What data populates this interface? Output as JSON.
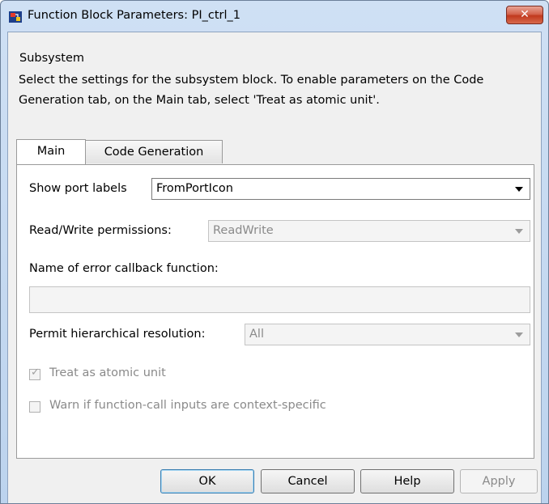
{
  "window": {
    "title": "Function Block Parameters: PI_ctrl_1",
    "close_symbol": "✕"
  },
  "group": {
    "label": "Subsystem",
    "description": "Select the settings for the subsystem block. To enable parameters on the Code Generation tab, on the Main tab, select 'Treat as atomic unit'."
  },
  "tabs": [
    {
      "label": "Main",
      "active": true
    },
    {
      "label": "Code Generation",
      "active": false
    }
  ],
  "main": {
    "show_port_labels": {
      "label": "Show port labels",
      "value": "FromPortIcon"
    },
    "read_write": {
      "label": "Read/Write permissions:",
      "value": "ReadWrite"
    },
    "error_callback": {
      "label": "Name of error callback function:",
      "value": ""
    },
    "hierarchical": {
      "label": "Permit hierarchical resolution:",
      "value": "All"
    },
    "treat_atomic": {
      "label": "Treat as atomic unit",
      "checked": true
    },
    "warn_context": {
      "label": "Warn if function-call inputs are context-specific",
      "checked": false
    }
  },
  "buttons": {
    "ok": "OK",
    "cancel": "Cancel",
    "help": "Help",
    "apply": "Apply"
  },
  "icons": {
    "app": "simulink-block-icon",
    "close": "close-icon",
    "dropdown": "chevron-down-icon",
    "check": "checkmark-icon"
  },
  "colors": {
    "title_gradient_top": "#cfe0f4",
    "close_button": "#c1391d",
    "default_button_border": "#3c7fb1",
    "disabled_text": "#8a8a8a"
  }
}
